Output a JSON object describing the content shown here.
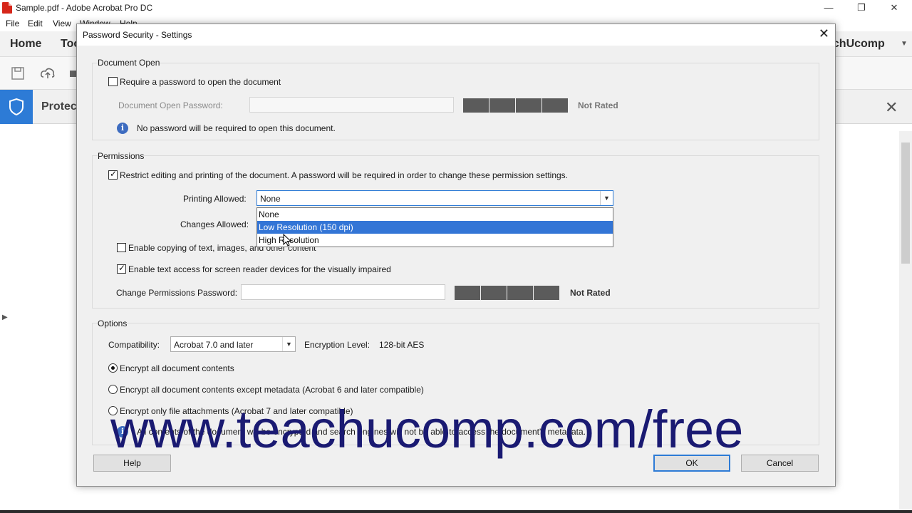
{
  "app": {
    "window_title": "Sample.pdf - Adobe Acrobat Pro DC",
    "menu": [
      "File",
      "Edit",
      "View",
      "Window",
      "Help"
    ],
    "nav": {
      "home": "Home",
      "tools": "Too",
      "user": "achUcomp"
    },
    "protect_label": "Protec"
  },
  "dialog": {
    "title": "Password Security - Settings",
    "document_open": {
      "group_label": "Document Open",
      "require_password_label": "Require a password to open the document",
      "require_password_checked": false,
      "password_field_label": "Document Open Password:",
      "password_value": "",
      "strength": "Not Rated",
      "info_text": "No password will be required to open this document."
    },
    "permissions": {
      "group_label": "Permissions",
      "restrict_label": "Restrict editing and printing of the document. A password will be required in order to change these permission settings.",
      "restrict_checked": true,
      "printing_label": "Printing Allowed:",
      "printing_value": "None",
      "printing_options": [
        "None",
        "Low Resolution (150 dpi)",
        "High Resolution"
      ],
      "printing_highlighted": "Low Resolution (150 dpi)",
      "changes_label": "Changes Allowed:",
      "copy_label": "Enable copying of text, images, and other content",
      "copy_checked": false,
      "screen_reader_label": "Enable text access for screen reader devices for the visually impaired",
      "screen_reader_checked": true,
      "perm_password_label": "Change Permissions Password:",
      "perm_password_value": "",
      "strength": "Not Rated"
    },
    "options": {
      "group_label": "Options",
      "compat_label": "Compatibility:",
      "compat_value": "Acrobat 7.0 and later",
      "encryption_label": "Encryption  Level:",
      "encryption_value": "128-bit AES",
      "radio_all": "Encrypt all document contents",
      "radio_except_metadata": "Encrypt all document contents except metadata (Acrobat 6 and later compatible)",
      "radio_attachments": "Encrypt only file attachments (Acrobat 7 and later compatible)",
      "selected_radio": "Encrypt all document contents",
      "info_text": "All contents of the document will be encrypted and search engines will not be able to access the document's metadata."
    },
    "buttons": {
      "help": "Help",
      "ok": "OK",
      "cancel": "Cancel"
    }
  },
  "watermark": "www.teachucomp.com/free",
  "colors": {
    "accent": "#2d7bd6",
    "selection": "#3375d6",
    "meter": "#5b5b5b",
    "watermark": "#1a1a72"
  }
}
